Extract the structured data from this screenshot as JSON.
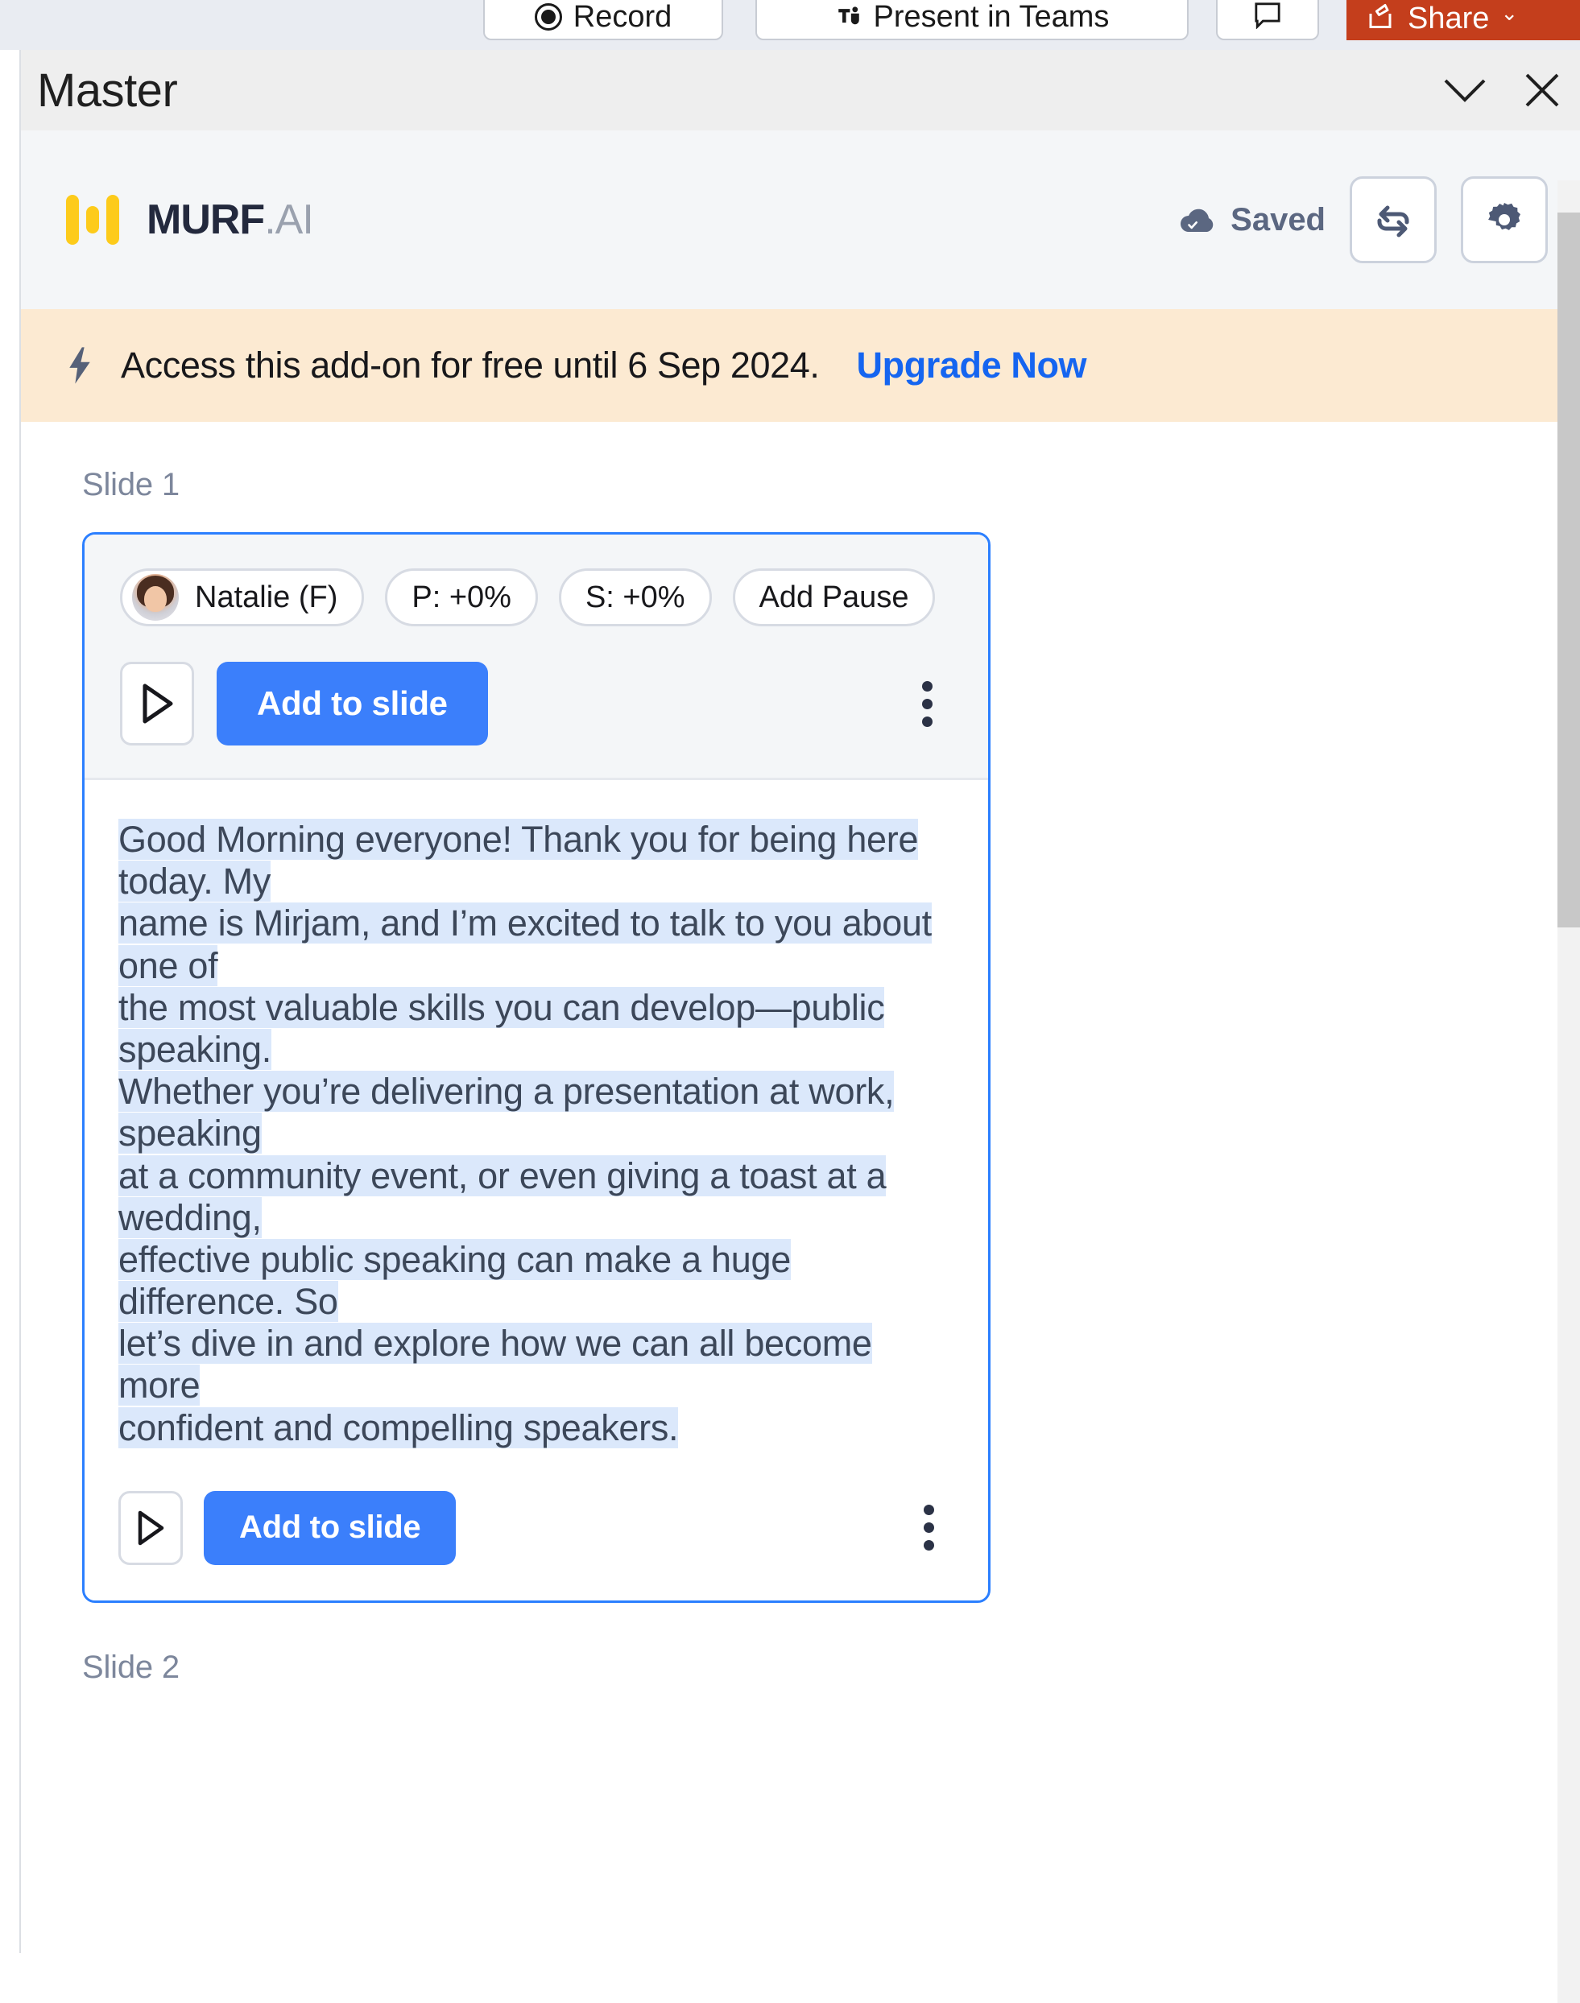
{
  "ribbon": {
    "record_label": "Record",
    "present_label": "Present in Teams",
    "share_label": "Share",
    "share_caret": "⌄",
    "record_icon": "record-dot-icon",
    "teams_icon": "teams-icon",
    "comment_icon": "comment-icon",
    "share_icon": "share-arrow-icon",
    "share_color": "#c43e1c"
  },
  "pane": {
    "title": "Master",
    "collapse_icon": "chevron-down-icon",
    "close_icon": "close-icon"
  },
  "app_header": {
    "logo_text_main": "MURF",
    "logo_text_suffix": ".AI",
    "logo_mark": "murf-waveform-icon",
    "logo_accent": "#fdcb1b",
    "saved_status": "Saved",
    "saved_icon": "cloud-check-icon",
    "sync_icon": "loop-refresh-icon",
    "settings_icon": "gear-icon"
  },
  "promo": {
    "icon": "lightning-bolt-icon",
    "message": "Access this add-on for free until 6 Sep 2024.",
    "link_label": "Upgrade Now",
    "link_color": "#1565f0",
    "background": "#fcead2"
  },
  "content": {
    "slide_1_label": "Slide 1",
    "slide_2_label": "Slide 2",
    "card": {
      "border_color": "#2b7fff",
      "chips": [
        {
          "id": "voice",
          "label": "Natalie (F)",
          "icon": "voice-avatar-icon"
        },
        {
          "id": "pitch",
          "label": "P: +0%"
        },
        {
          "id": "speed",
          "label": "S: +0%"
        },
        {
          "id": "pause",
          "label": "Add Pause"
        }
      ],
      "play_icon": "play-icon",
      "add_to_slide_label": "Add to slide",
      "add_button_color": "#3b7ffb",
      "more_icon": "kebab-menu-icon",
      "script_text": "Good Morning everyone! Thank you for being here today. My name is Mirjam, and I’m excited to talk to you about one of the most valuable skills you can develop—public speaking. Whether you’re delivering a presentation at work, speaking at a community event, or even giving a toast at a wedding, effective public speaking can make a huge difference. So let’s dive in and explore how we can all become more confident and compelling speakers.",
      "script_lines": [
        "Good Morning everyone! Thank you for being here today. My",
        "name is Mirjam, and I’m excited to talk to you about one of",
        "the most valuable skills you can develop—public speaking.",
        "Whether you’re delivering a presentation at work, speaking",
        "at a community event, or even giving a toast at a wedding,",
        "effective public speaking can make a huge difference. So",
        "let’s dive in and explore how we can all become more",
        "confident and compelling speakers."
      ],
      "selection_color": "#dbe8fb",
      "play_icon_bottom": "play-icon",
      "add_to_slide_label_bottom": "Add to slide",
      "more_icon_bottom": "kebab-menu-icon"
    }
  },
  "scrollbar": {
    "name": "vertical-scrollbar"
  }
}
